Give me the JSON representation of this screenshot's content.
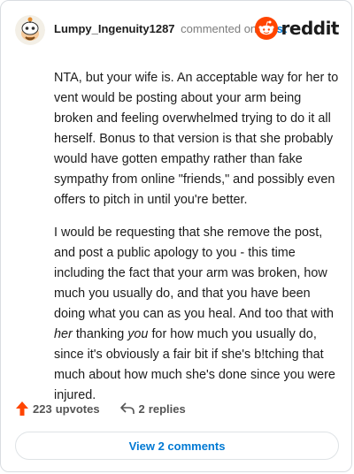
{
  "header": {
    "username": "Lumpy_Ingenuity1287",
    "commented": "commented on",
    "post_link": "post",
    "brand": "reddit",
    "brand_color": "#ff4500"
  },
  "comment": {
    "paragraphs": [
      "NTA, but your wife is. An acceptable way for her to vent would be posting about your arm being broken and feeling overwhelmed trying to do it all herself. Bonus to that version is that she probably would have gotten empathy rather than fake sympathy from online \"friends,\" and possibly even offers to pitch in until you're better.",
      "and post a public apology to you - this time including the fact that your arm was broken, how much you usually do, and that you have been doing what you can as you heal. And too that with"
    ],
    "p2_lead": "I would be requesting that she remove the post,",
    "p2_em1": "her",
    "p2_mid": "thanking",
    "p2_em2": "you",
    "p2_tail": "for how much you usually do, since it's obviously a fair bit if she's b!tching that much about how much she's done since you were injured."
  },
  "footer": {
    "upvotes_count": "223",
    "upvotes_word": "upvotes",
    "replies_count": "2",
    "replies_word": "replies",
    "upvote_icon": "upvote-arrow-icon",
    "reply_icon": "reply-arrow-icon",
    "upvote_color": "#ff4500"
  },
  "view_comments": "View 2 comments"
}
